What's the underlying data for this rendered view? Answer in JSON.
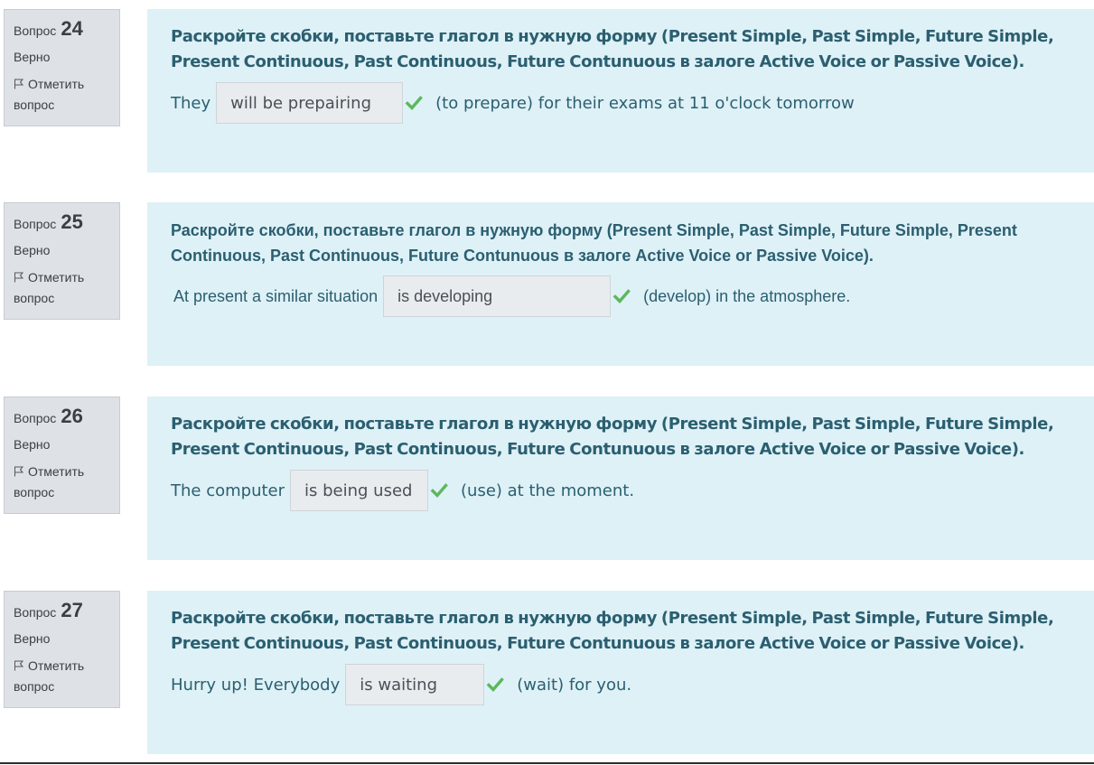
{
  "questions": [
    {
      "label": "Вопрос",
      "number": "24",
      "state": "Верно",
      "flag_label": "Отметить вопрос",
      "text": "Раскройте скобки, поставьте глагол в нужную форму (Present Simple, Past Simple, Future Simple, Present Continuous, Past Continuous, Future Contunuous в залоге Active Voice or Passive Voice).",
      "before": "They",
      "answer": "will be prepairing",
      "after": "(to prepare) for their exams at 11 o'clock tomorrow"
    },
    {
      "label": "Вопрос",
      "number": "25",
      "state": "Верно",
      "flag_label": "Отметить вопрос",
      "text": "Раскройте скобки, поставьте глагол в нужную форму (Present Simple, Past Simple, Future Simple, Present Continuous, Past Continuous, Future Contunuous в залоге Active Voice or Passive Voice).",
      "before": "At present a similar situation",
      "answer": "is developing",
      "after": "(develop) in the atmosphere."
    },
    {
      "label": "Вопрос",
      "number": "26",
      "state": "Верно",
      "flag_label": "Отметить вопрос",
      "text": "Раскройте скобки, поставьте глагол в нужную форму (Present Simple, Past Simple, Future Simple, Present Continuous, Past Continuous, Future Contunuous в залоге Active Voice or Passive Voice).",
      "before": "The computer",
      "answer": "is being used",
      "after": "(use) at the moment."
    },
    {
      "label": "Вопрос",
      "number": "27",
      "state": "Верно",
      "flag_label": "Отметить вопрос",
      "text": "Раскройте скобки, поставьте глагол в нужную форму (Present Simple, Past Simple, Future Simple, Present Continuous, Past Continuous, Future Contunuous в залоге Active Voice or Passive Voice).",
      "before": "Hurry up! Everybody",
      "answer": "is waiting",
      "after": "(wait) for you."
    }
  ],
  "colors": {
    "info_bg": "#dee2e6",
    "content_bg": "#def1f7",
    "text": "#2b5f70",
    "correct": "#5cb85c"
  },
  "icons": {
    "flag": "flag-outline-icon",
    "correct": "check-icon"
  }
}
